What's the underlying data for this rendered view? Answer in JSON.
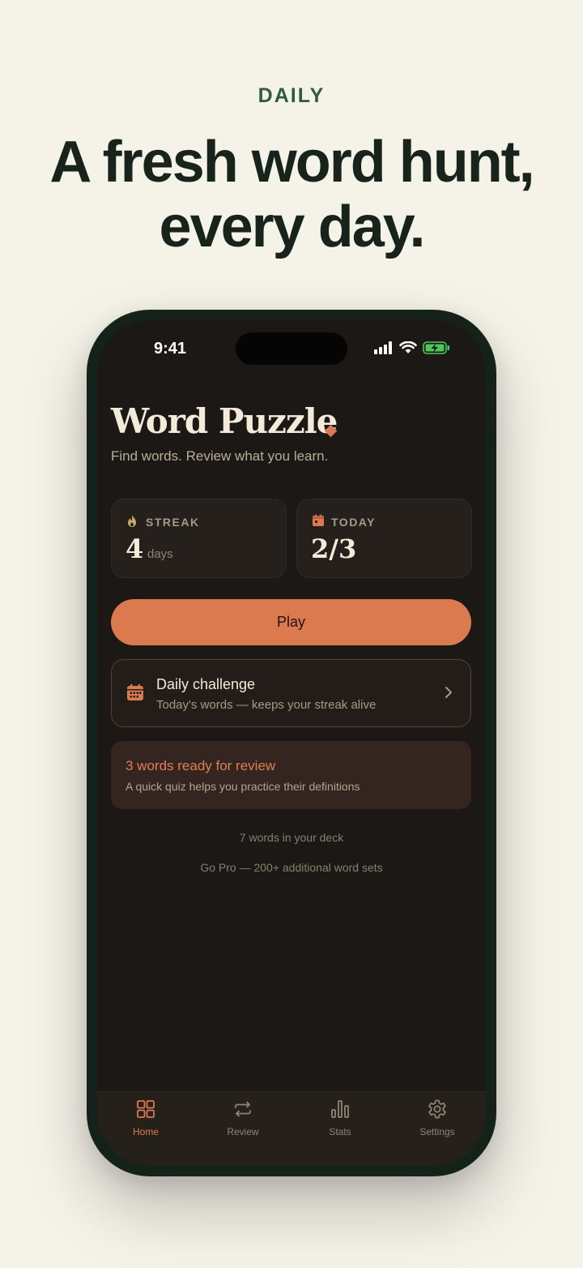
{
  "marketing": {
    "eyebrow": "DAILY",
    "headline_line1": "A fresh word hunt,",
    "headline_line2": "every day."
  },
  "status_bar": {
    "time": "9:41"
  },
  "app": {
    "title": "Word Puzzle",
    "subtitle": "Find words. Review what you learn."
  },
  "stats": {
    "streak": {
      "label": "STREAK",
      "value": "4",
      "unit": "days",
      "icon": "flame-icon"
    },
    "today": {
      "label": "TODAY",
      "value": "2/3",
      "icon": "calendar-icon"
    }
  },
  "play_button": {
    "label": "Play"
  },
  "daily_challenge": {
    "title": "Daily challenge",
    "subtitle": "Today's words — keeps your streak alive",
    "icon": "calendar-grid-icon"
  },
  "review": {
    "title": "3 words ready for review",
    "subtitle": "A quick quiz helps you practice their definitions"
  },
  "deck": {
    "count_text": "7 words in your deck",
    "pro_text": "Go Pro — 200+ additional word sets"
  },
  "tabs": [
    {
      "label": "Home",
      "icon": "grid-icon",
      "active": true
    },
    {
      "label": "Review",
      "icon": "repeat-icon",
      "active": false
    },
    {
      "label": "Stats",
      "icon": "bar-chart-icon",
      "active": false
    },
    {
      "label": "Settings",
      "icon": "gear-icon",
      "active": false
    }
  ],
  "colors": {
    "accent": "#dc7a4f",
    "background": "#f5f2e8",
    "screen": "#1c1815",
    "eyebrow": "#2e5c3e"
  }
}
